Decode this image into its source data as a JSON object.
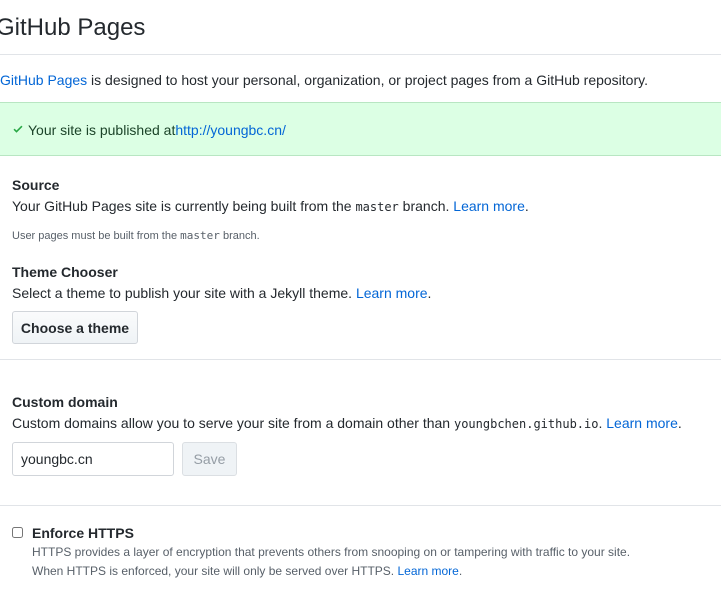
{
  "page": {
    "title": "GitHub Pages"
  },
  "intro": {
    "link": "GitHub Pages",
    "text": " is designed to host your personal, organization, or project pages from a GitHub repository."
  },
  "flash": {
    "prefix": "Your site is published at ",
    "url": "http://youngbc.cn/"
  },
  "source": {
    "heading": "Source",
    "text_before": "Your GitHub Pages site is currently being built from the ",
    "branch": "master",
    "text_after": " branch. ",
    "learn_more": "Learn more",
    "end": ".",
    "note_before": "User pages must be built from the ",
    "note_branch": "master",
    "note_after": " branch."
  },
  "theme": {
    "heading": "Theme Chooser",
    "text": "Select a theme to publish your site with a Jekyll theme. ",
    "learn_more": "Learn more",
    "end": ".",
    "button": "Choose a theme"
  },
  "domain": {
    "heading": "Custom domain",
    "text": "Custom domains allow you to serve your site from a domain other than ",
    "default_domain": "youngbchen.github.io",
    "after": ". ",
    "learn_more": "Learn more",
    "end": ".",
    "input_value": "youngbc.cn",
    "save": "Save"
  },
  "https": {
    "label": "Enforce HTTPS",
    "line1": "HTTPS provides a layer of encryption that prevents others from snooping on or tampering with traffic to your site.",
    "line2": "When HTTPS is enforced, your site will only be served over HTTPS. ",
    "learn_more": "Learn more",
    "end": "."
  }
}
